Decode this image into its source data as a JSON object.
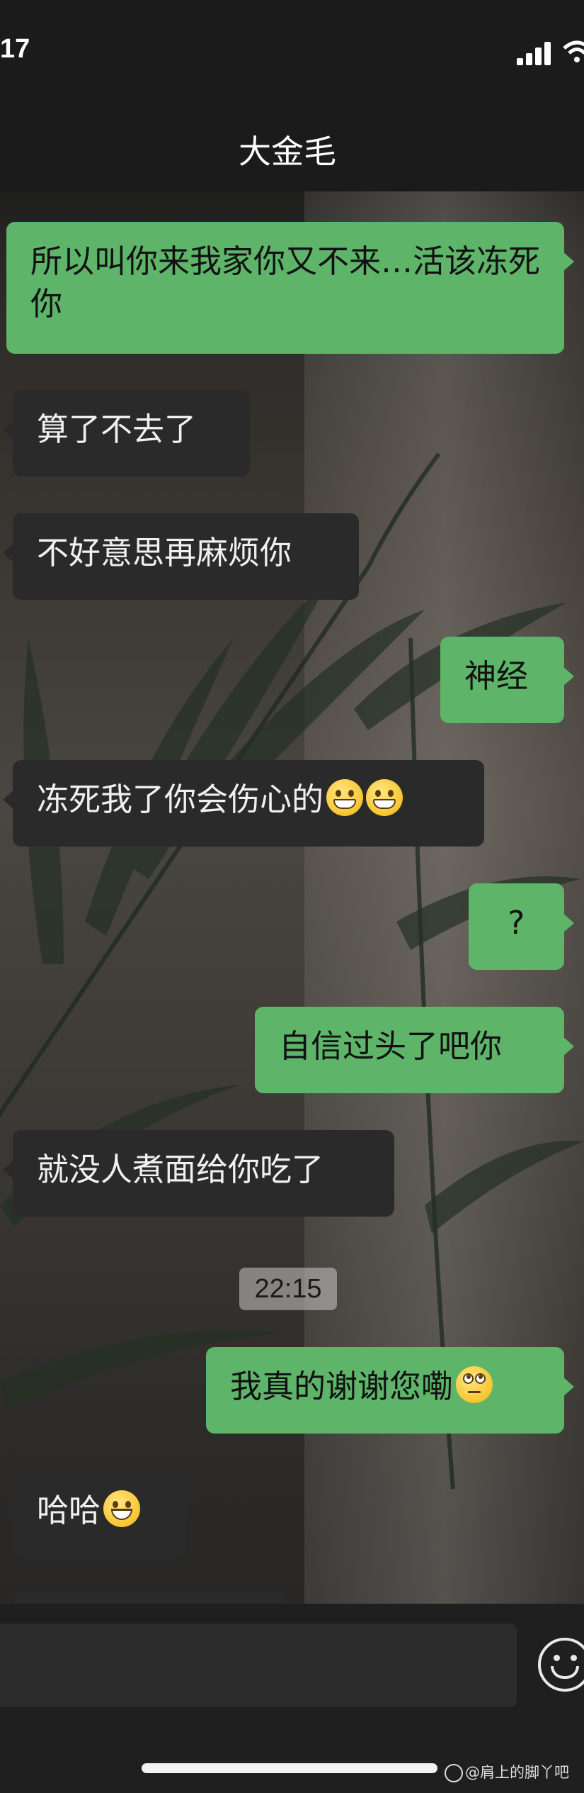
{
  "status_bar": {
    "time": "17"
  },
  "header": {
    "title": "大金毛"
  },
  "messages": [
    {
      "side": "out",
      "text": "所以叫你来我家你又不来…活该冻死你"
    },
    {
      "side": "in",
      "text": "算了不去了"
    },
    {
      "side": "in",
      "text": "不好意思再麻烦你"
    },
    {
      "side": "out",
      "text": "神经"
    },
    {
      "side": "in",
      "text": "冻死我了你会伤心的",
      "emoji": [
        "grinning-face-with-smiling-eyes",
        "grinning-face-with-smiling-eyes"
      ]
    },
    {
      "side": "out",
      "text": "?"
    },
    {
      "side": "out",
      "text": "自信过头了吧你"
    },
    {
      "side": "in",
      "text": "就没人煮面给你吃了"
    },
    {
      "side": "out",
      "text": "我真的谢谢您嘞",
      "emoji": [
        "face-with-rolling-eyes"
      ]
    },
    {
      "side": "in",
      "text": "哈哈",
      "emoji": [
        "grinning-face"
      ]
    }
  ],
  "timestamp": "22:15",
  "input": {
    "emoji_button_icon": "smiley-icon"
  },
  "watermark": {
    "text": "@肩上的脚丫吧"
  },
  "colors": {
    "outgoing_bubble": "#5eb56a",
    "incoming_bubble": "#2a2a2a"
  }
}
